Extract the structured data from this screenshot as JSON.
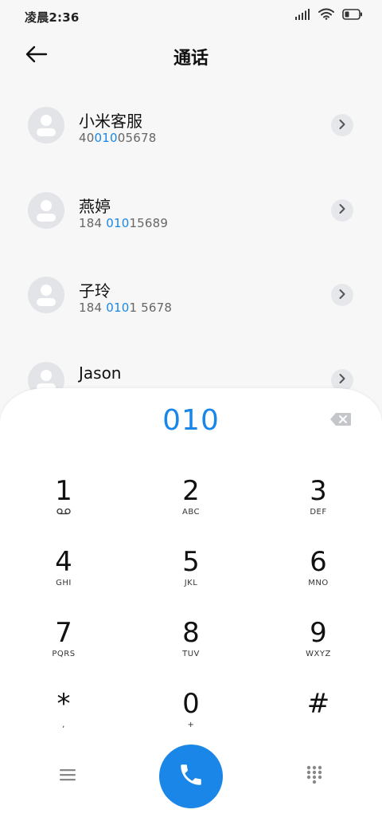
{
  "status_bar": {
    "time": "凌晨2:36",
    "icons": [
      "signal-icon",
      "wifi-icon",
      "battery-icon"
    ]
  },
  "header": {
    "back_icon": "arrow-left-icon",
    "title": "通话"
  },
  "contacts": [
    {
      "name": "小米客服",
      "number_parts": [
        "40",
        "010",
        "05678"
      ]
    },
    {
      "name": "燕婷",
      "number_parts": [
        "184 ",
        "010",
        "15689"
      ]
    },
    {
      "name": "子玲",
      "number_parts": [
        "184 ",
        "010",
        "1 5678"
      ]
    },
    {
      "name": "Jason",
      "number_parts": [
        "",
        "",
        ""
      ]
    }
  ],
  "dialer": {
    "input_value": "010",
    "backspace_icon": "backspace-icon",
    "keys": [
      {
        "digit": "1",
        "letters": ""
      },
      {
        "digit": "2",
        "letters": "ABC"
      },
      {
        "digit": "3",
        "letters": "DEF"
      },
      {
        "digit": "4",
        "letters": "GHI"
      },
      {
        "digit": "5",
        "letters": "JKL"
      },
      {
        "digit": "6",
        "letters": "MNO"
      },
      {
        "digit": "7",
        "letters": "PQRS"
      },
      {
        "digit": "8",
        "letters": "TUV"
      },
      {
        "digit": "9",
        "letters": "WXYZ"
      },
      {
        "digit": "*",
        "letters": ","
      },
      {
        "digit": "0",
        "letters": "+"
      },
      {
        "digit": "#",
        "letters": ""
      }
    ],
    "bottom_icons": {
      "menu": "menu-icon",
      "call": "phone-icon",
      "keypad": "dialpad-icon"
    }
  },
  "colors": {
    "accent": "#1a87e8",
    "background": "#f7f7f7",
    "panel": "#ffffff",
    "avatar": "#e2e4e8"
  }
}
